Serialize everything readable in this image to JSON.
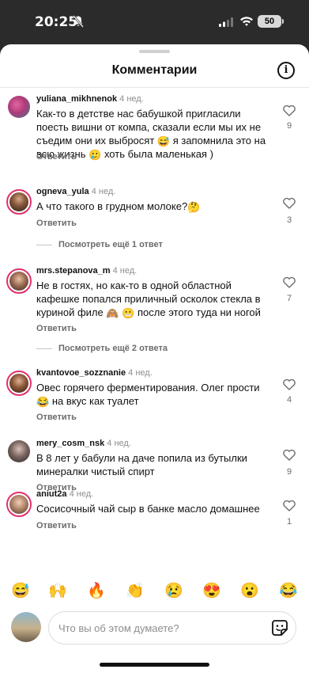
{
  "status_bar": {
    "time": "20:25",
    "battery": "50"
  },
  "header": {
    "title": "Комментарии",
    "info_label": "i"
  },
  "comments": [
    {
      "username": "yuliana_mikhnenok",
      "time": "4 нед.",
      "text_parts": [
        "Как-то в детстве нас бабушкой пригласили поесть вишни от компа, сказали если мы их не съедим они их выбросят",
        "😅",
        "я запомнила это на всю жизнь",
        "🥲",
        "хоть была маленькая )"
      ],
      "reply_label": "Ответить",
      "likes": "9"
    },
    {
      "username": "ogneva_yula",
      "time": "4 нед.",
      "text_parts": [
        "А что такого в грудном молоке?",
        "🤔"
      ],
      "reply_label": "Ответить",
      "likes": "3",
      "more_replies": "Посмотреть ещё 1 ответ"
    },
    {
      "username": "mrs.stepanova_m",
      "time": "4 нед.",
      "text_parts": [
        "Не в гостях, но как-то в одной областной кафешке попался приличный осколок стекла в куриной филе",
        "🙈",
        "😬",
        "после этого туда ни ногой"
      ],
      "reply_label": "Ответить",
      "likes": "7",
      "more_replies": "Посмотреть ещё 2 ответа"
    },
    {
      "username": "kvantovoe_sozznanie",
      "time": "4 нед.",
      "text_parts": [
        "Овес горячего ферментирования. Олег прости",
        "😂",
        "на вкус как туалет"
      ],
      "reply_label": "Ответить",
      "likes": "4"
    },
    {
      "username": "mery_cosm_nsk",
      "time": "4 нед.",
      "text_parts": [
        "В 8 лет у бабули на даче попила из бутылки минералки чистый спирт"
      ],
      "reply_label": "Ответить",
      "likes": "9"
    },
    {
      "username": "aniut2a",
      "time": "4 нед.",
      "text_parts": [
        "Сосисочный чай сыр в банке масло домашнее"
      ],
      "reply_label": "Ответить",
      "likes": "1"
    }
  ],
  "reactions": [
    "😅",
    "🙌",
    "🔥",
    "👏",
    "😢",
    "😍",
    "😮",
    "😂"
  ],
  "composer": {
    "placeholder": "Что вы об этом думаете?"
  },
  "colors": {
    "story_ring": "#e1306c",
    "sheet_bg": "#ffffff",
    "backdrop": "#2b2b2b"
  },
  "icons": {
    "mute": "bell-slash-icon",
    "signal": "cellular-signal-icon",
    "wifi": "wifi-icon",
    "like": "heart-outline-icon",
    "sticker": "sticker-icon",
    "info": "info-icon"
  }
}
